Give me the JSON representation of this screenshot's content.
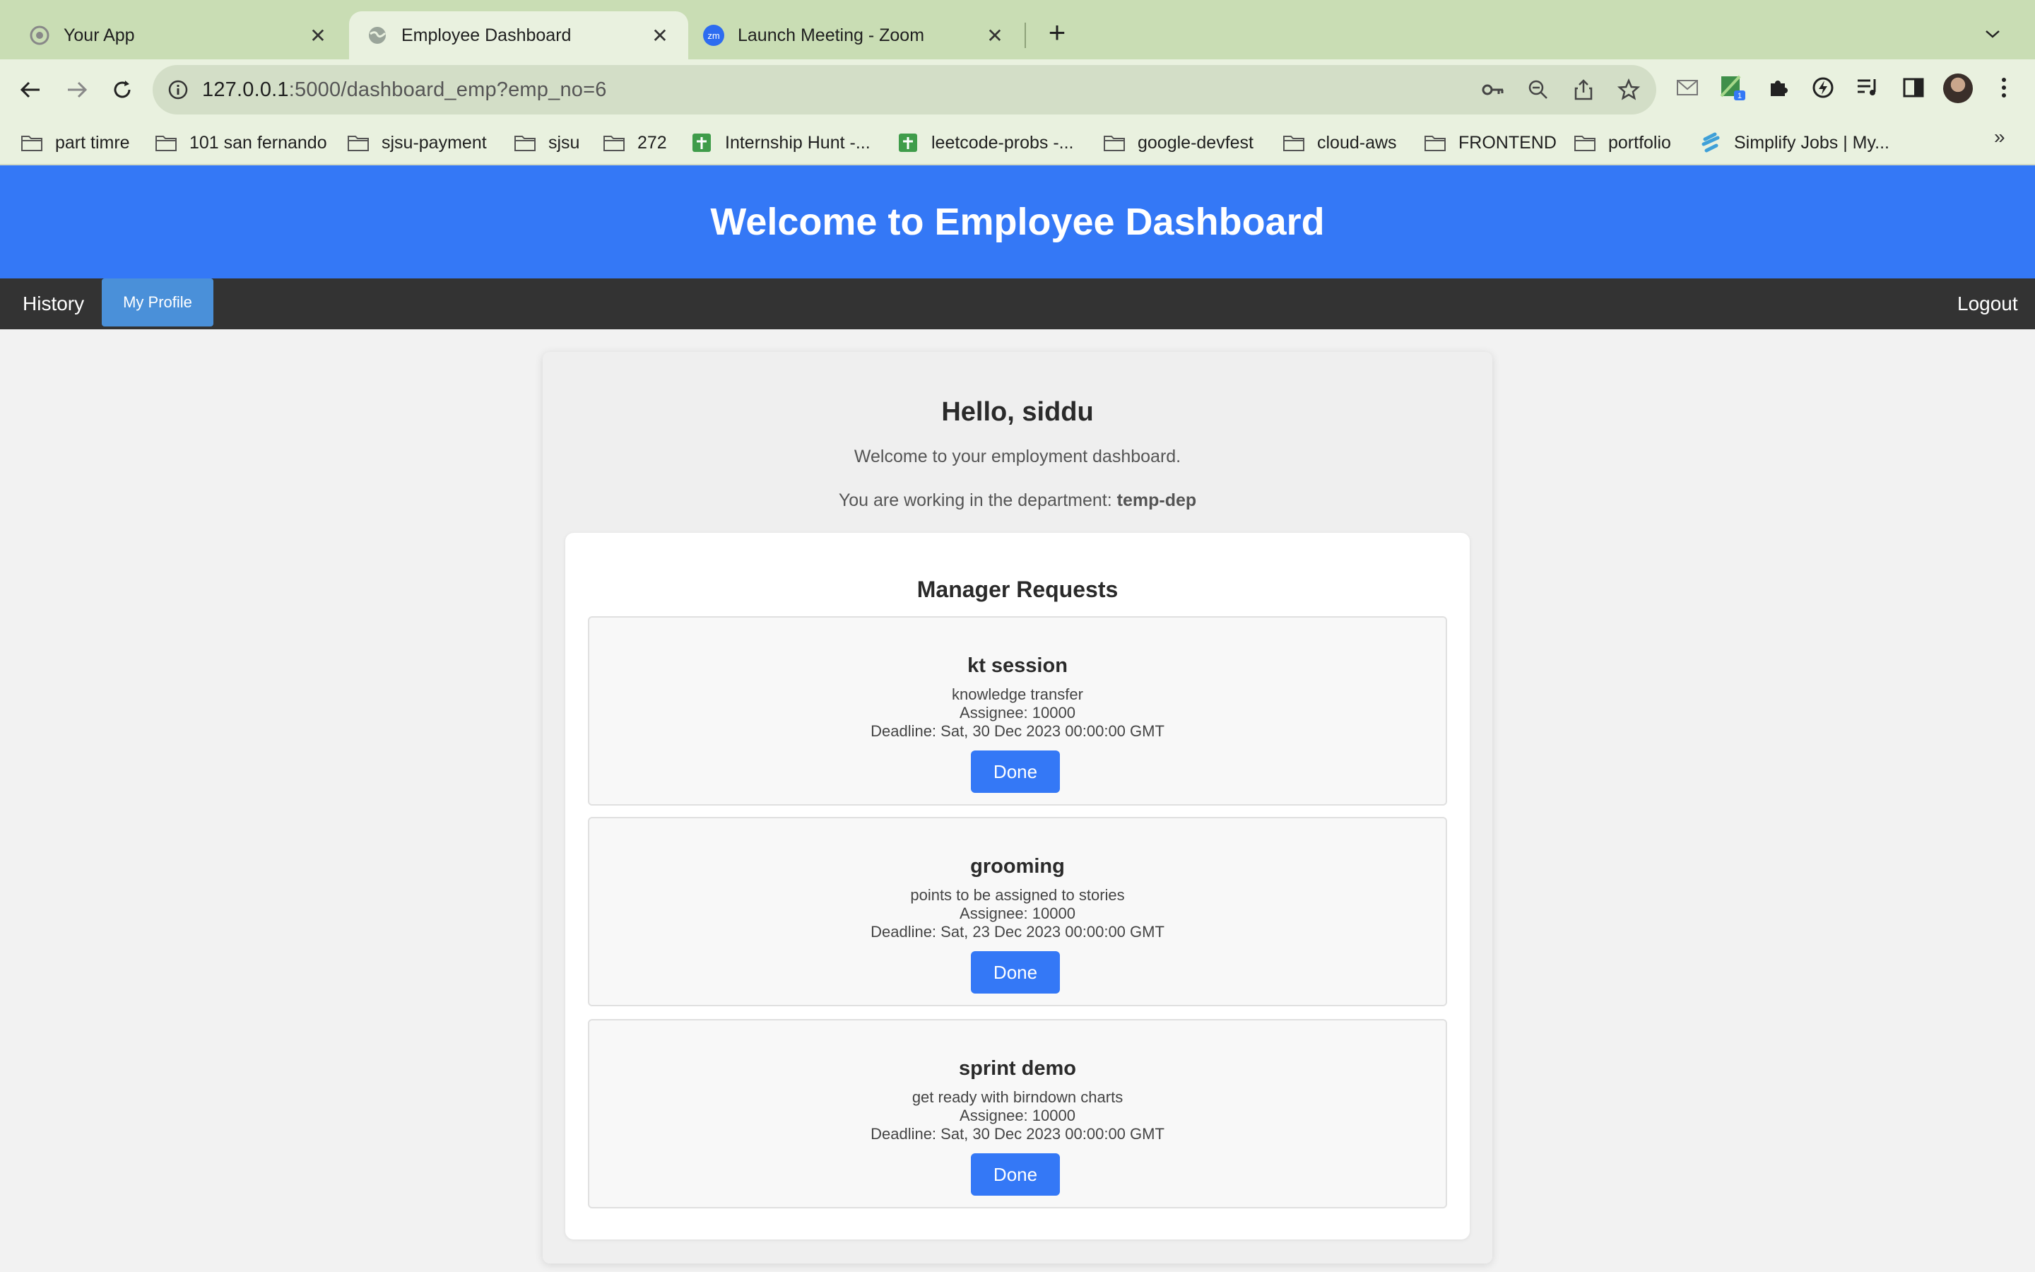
{
  "browser": {
    "tabs": [
      {
        "title": "Your App",
        "icon": "gear-favicon",
        "active": false
      },
      {
        "title": "Employee Dashboard",
        "icon": "globe-favicon",
        "active": true
      },
      {
        "title": "Launch Meeting - Zoom",
        "icon": "zoom-favicon",
        "favicon_text": "zm",
        "active": false
      }
    ],
    "url_host": "127.0.0.1",
    "url_path": ":5000/dashboard_emp?emp_no=6",
    "extension_badge": "1",
    "bookmarks": [
      {
        "label": "part timre",
        "icon": "folder-icon"
      },
      {
        "label": "101 san fernando",
        "icon": "folder-icon"
      },
      {
        "label": "sjsu-payment",
        "icon": "folder-icon"
      },
      {
        "label": "sjsu",
        "icon": "folder-icon"
      },
      {
        "label": "272",
        "icon": "folder-icon"
      },
      {
        "label": "Internship Hunt -...",
        "icon": "sheets-icon"
      },
      {
        "label": "leetcode-probs -...",
        "icon": "sheets-icon"
      },
      {
        "label": "google-devfest",
        "icon": "folder-icon"
      },
      {
        "label": "cloud-aws",
        "icon": "folder-icon"
      },
      {
        "label": "FRONTEND",
        "icon": "folder-icon"
      },
      {
        "label": "portfolio",
        "icon": "folder-icon"
      },
      {
        "label": "Simplify Jobs | My...",
        "icon": "simplify-icon"
      }
    ],
    "bookmarks_overflow": "»"
  },
  "page": {
    "header_title": "Welcome to Employee Dashboard",
    "nav": {
      "history": "History",
      "profile": "My Profile",
      "logout": "Logout"
    },
    "greeting": "Hello, siddu",
    "welcome": "Welcome to your employment dashboard.",
    "department_prefix": "You are working in the department:",
    "department": "temp-dep",
    "requests_title": "Manager Requests",
    "requests": [
      {
        "title": "kt session",
        "description": "knowledge transfer",
        "assignee": "Assignee: 10000",
        "deadline": "Deadline: Sat, 30 Dec 2023 00:00:00 GMT",
        "button": "Done"
      },
      {
        "title": "grooming",
        "description": "points to be assigned to stories",
        "assignee": "Assignee: 10000",
        "deadline": "Deadline: Sat, 23 Dec 2023 00:00:00 GMT",
        "button": "Done"
      },
      {
        "title": "sprint demo",
        "description": "get ready with birndown charts",
        "assignee": "Assignee: 10000",
        "deadline": "Deadline: Sat, 30 Dec 2023 00:00:00 GMT",
        "button": "Done"
      }
    ]
  },
  "colors": {
    "header_blue": "#3478f6",
    "nav_dark": "#333333",
    "profile_button": "#4a90d9",
    "done_button": "#3478f6",
    "chrome_green": "#c9ddb4"
  }
}
